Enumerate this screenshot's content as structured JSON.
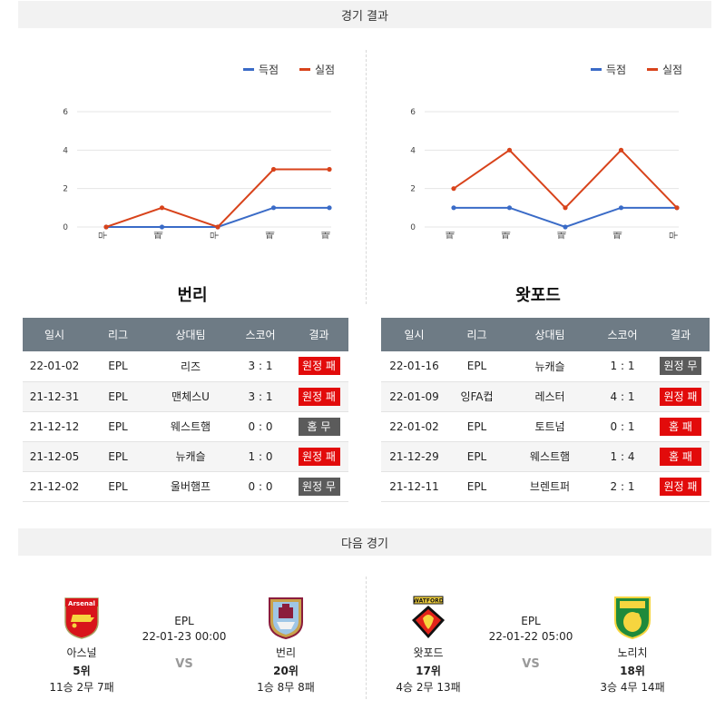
{
  "sections": {
    "results_title": "경기 결과",
    "next_title": "다음 경기"
  },
  "legend": {
    "scored": "득점",
    "conceded": "실점"
  },
  "colors": {
    "scored": "#3a6bc7",
    "conceded": "#d8431b",
    "win_red": "#e20b0b",
    "neutral_gray": "#5b5b5b",
    "header": "#6e7b85"
  },
  "chart_data": [
    {
      "type": "line",
      "categories": [
        "무",
        "패",
        "무",
        "패",
        "패"
      ],
      "series": [
        {
          "name": "득점",
          "values": [
            0,
            0,
            0,
            1,
            1
          ]
        },
        {
          "name": "실점",
          "values": [
            0,
            1,
            0,
            3,
            3
          ]
        }
      ],
      "y_ticks": [
        "0",
        "2",
        "4",
        "6"
      ],
      "ylim": [
        0,
        6
      ],
      "legend_position": "top-right",
      "grid": true
    },
    {
      "type": "line",
      "categories": [
        "패",
        "패",
        "패",
        "패",
        "무"
      ],
      "series": [
        {
          "name": "득점",
          "values": [
            1,
            1,
            0,
            1,
            1
          ]
        },
        {
          "name": "실점",
          "values": [
            2,
            4,
            1,
            4,
            1
          ]
        }
      ],
      "y_ticks": [
        "0",
        "2",
        "4",
        "6"
      ],
      "ylim": [
        0,
        6
      ],
      "legend_position": "top-right",
      "grid": true
    }
  ],
  "left": {
    "team_name": "번리",
    "headers": [
      "일시",
      "리그",
      "상대팀",
      "스코어",
      "결과"
    ],
    "rows": [
      {
        "date": "22-01-02",
        "league": "EPL",
        "opponent": "리즈",
        "score": "3 : 1",
        "result": "원정 패",
        "color": "red"
      },
      {
        "date": "21-12-31",
        "league": "EPL",
        "opponent": "맨체스U",
        "score": "3 : 1",
        "result": "원정 패",
        "color": "red"
      },
      {
        "date": "21-12-12",
        "league": "EPL",
        "opponent": "웨스트햄",
        "score": "0 : 0",
        "result": "홈 무",
        "color": "gray"
      },
      {
        "date": "21-12-05",
        "league": "EPL",
        "opponent": "뉴캐슬",
        "score": "1 : 0",
        "result": "원정 패",
        "color": "red"
      },
      {
        "date": "21-12-02",
        "league": "EPL",
        "opponent": "울버햄프",
        "score": "0 : 0",
        "result": "원정 무",
        "color": "gray"
      }
    ]
  },
  "right": {
    "team_name": "왓포드",
    "headers": [
      "일시",
      "리그",
      "상대팀",
      "스코어",
      "결과"
    ],
    "rows": [
      {
        "date": "22-01-16",
        "league": "EPL",
        "opponent": "뉴캐슬",
        "score": "1 : 1",
        "result": "원정 무",
        "color": "gray"
      },
      {
        "date": "22-01-09",
        "league": "잉FA컵",
        "opponent": "레스터",
        "score": "4 : 1",
        "result": "원정 패",
        "color": "red"
      },
      {
        "date": "22-01-02",
        "league": "EPL",
        "opponent": "토트넘",
        "score": "0 : 1",
        "result": "홈 패",
        "color": "red"
      },
      {
        "date": "21-12-29",
        "league": "EPL",
        "opponent": "웨스트햄",
        "score": "1 : 4",
        "result": "홈 패",
        "color": "red"
      },
      {
        "date": "21-12-11",
        "league": "EPL",
        "opponent": "브렌트퍼",
        "score": "2 : 1",
        "result": "원정 패",
        "color": "red"
      }
    ]
  },
  "next_matches": [
    {
      "league": "EPL",
      "datetime": "22-01-23 00:00",
      "vs": "VS",
      "home": {
        "name": "아스널",
        "rank": "5위",
        "record": "11승 2무 7패",
        "logo_text": "Arsenal",
        "icon": "arsenal-crest"
      },
      "away": {
        "name": "번리",
        "rank": "20위",
        "record": "1승 8무 8패",
        "icon": "burnley-crest"
      }
    },
    {
      "league": "EPL",
      "datetime": "22-01-22 05:00",
      "vs": "VS",
      "home": {
        "name": "왓포드",
        "rank": "17위",
        "record": "4승 2무 13패",
        "logo_text": "WATFORD",
        "icon": "watford-crest"
      },
      "away": {
        "name": "노리치",
        "rank": "18위",
        "record": "3승 4무 14패",
        "icon": "norwich-crest"
      }
    }
  ]
}
